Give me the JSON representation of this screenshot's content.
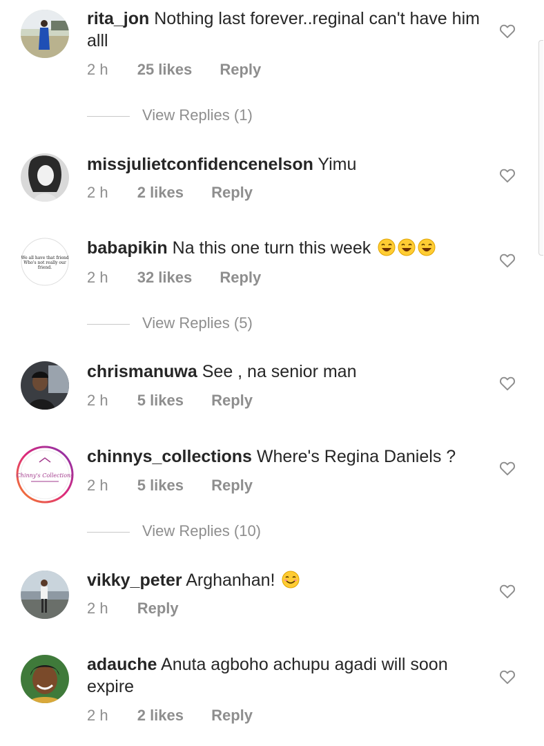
{
  "comments": [
    {
      "username": "rita_jon",
      "text": "Nothing last forever..reginal can't have him alll",
      "time": "2 h",
      "likes": "25 likes",
      "reply": "Reply",
      "view_replies": "View Replies (1)",
      "avatar": "avatar-woman-blue-dress"
    },
    {
      "username": "missjulietconfidencenelson",
      "text": "Yimu",
      "time": "2 h",
      "likes": "2 likes",
      "reply": "Reply",
      "avatar": "avatar-woman-bw"
    },
    {
      "username": "babapikin",
      "text": "Na this one turn this week",
      "emojis": "laughing-emoji x3",
      "time": "2 h",
      "likes": "32 likes",
      "reply": "Reply",
      "view_replies": "View Replies (5)",
      "avatar": "avatar-text-quote",
      "avatar_text": [
        "We all have that friend",
        "Who's not really our",
        "friend."
      ]
    },
    {
      "username": "chrismanuwa",
      "text": "See , na senior man",
      "time": "2 h",
      "likes": "5 likes",
      "reply": "Reply",
      "avatar": "avatar-man-car"
    },
    {
      "username": "chinnys_collections",
      "text": "Where's Regina Daniels ?",
      "time": "2 h",
      "likes": "5 likes",
      "reply": "Reply",
      "view_replies": "View Replies (10)",
      "avatar": "avatar-story-ring-logo",
      "avatar_text": "Chinny's Collections"
    },
    {
      "username": "vikky_peter",
      "text": "Arghanhan!",
      "emojis": "smiling-emoji",
      "time": "2 h",
      "reply": "Reply",
      "avatar": "avatar-person-outdoor"
    },
    {
      "username": "adauche",
      "text": "Anuta agboho achupu agadi will soon expire",
      "time": "2 h",
      "likes": "2 likes",
      "reply": "Reply",
      "avatar": "avatar-woman-smiling"
    }
  ],
  "colors": {
    "text": "#262626",
    "meta": "#8e8e8e",
    "story_ring": [
      "#f58529",
      "#dd2a7b",
      "#8134af"
    ],
    "heart_outline": "#8e8e8e"
  }
}
